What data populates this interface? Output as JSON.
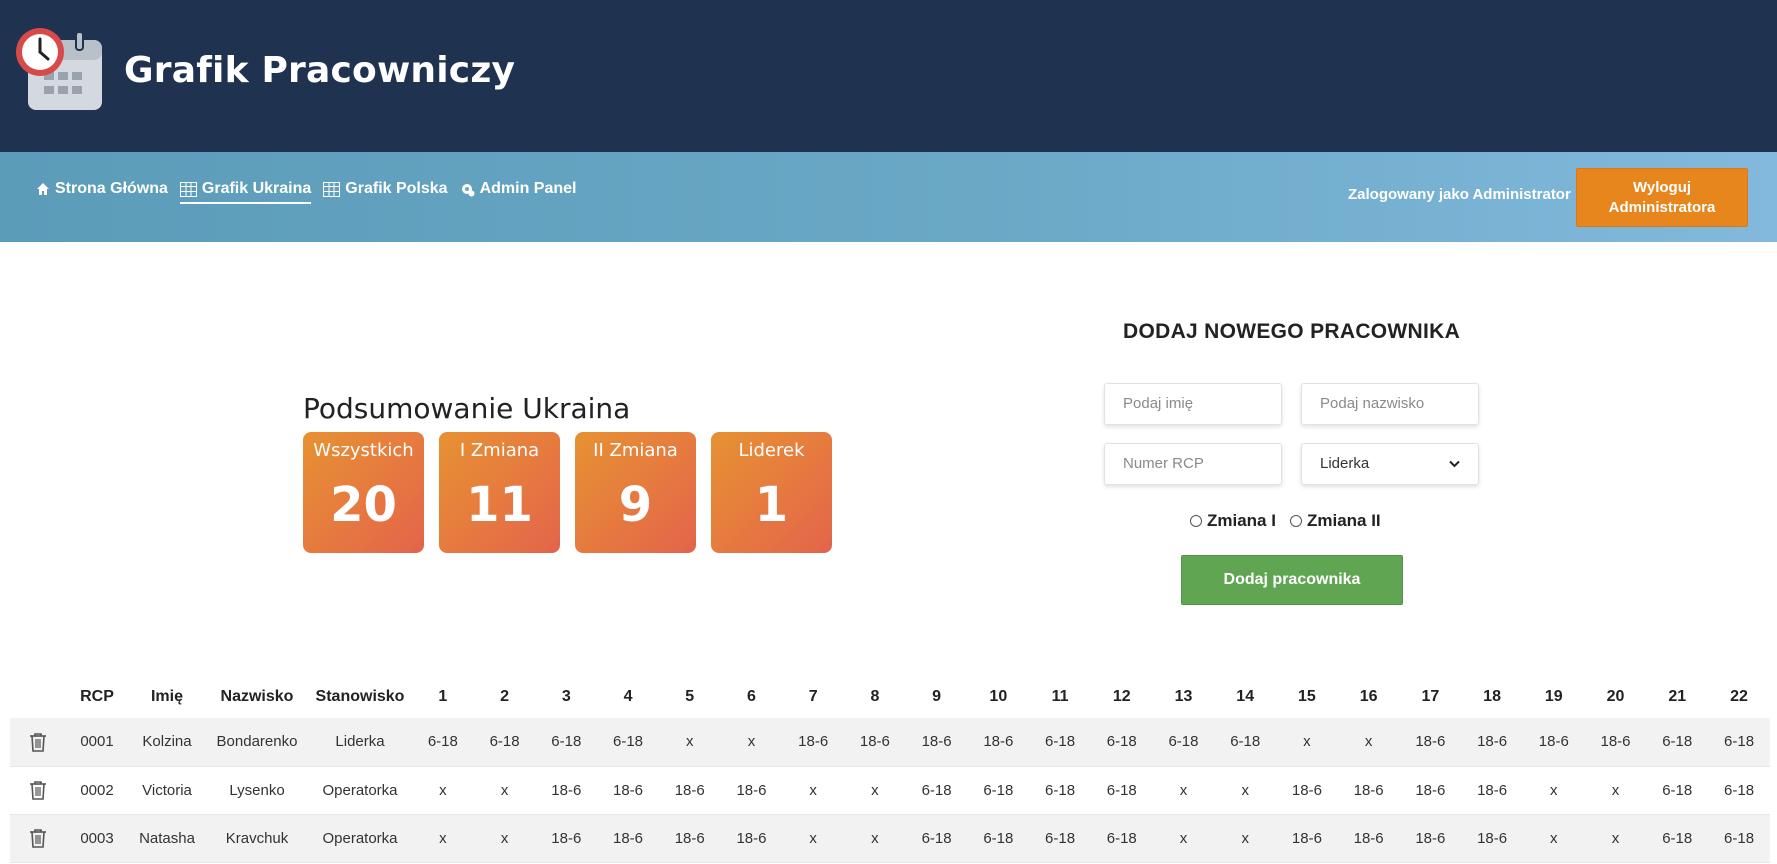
{
  "header": {
    "title": "Grafik Pracowniczy",
    "logo_icon": "calendar-clock-icon"
  },
  "nav": {
    "items": [
      {
        "label": "Strona Główna",
        "icon": "home-icon",
        "active": false
      },
      {
        "label": "Grafik Ukraina",
        "icon": "table-icon",
        "active": true
      },
      {
        "label": "Grafik Polska",
        "icon": "table-icon",
        "active": false
      },
      {
        "label": "Admin Panel",
        "icon": "admin-icon",
        "active": false
      }
    ],
    "logged_as": "Zalogowany jako Administrator",
    "logout_label_line1": "Wyloguj",
    "logout_label_line2": "Administratora"
  },
  "summary": {
    "title": "Podsumowanie Ukraina",
    "cards": [
      {
        "label": "Wszystkich",
        "value": "20"
      },
      {
        "label": "I Zmiana",
        "value": "11"
      },
      {
        "label": "II Zmiana",
        "value": "9"
      },
      {
        "label": "Liderek",
        "value": "1"
      }
    ]
  },
  "form": {
    "title": "DODAJ NOWEGO PRACOWNIKA",
    "first_name_placeholder": "Podaj imię",
    "last_name_placeholder": "Podaj nazwisko",
    "rcp_placeholder": "Numer RCP",
    "position_selected": "Liderka",
    "shift_options": [
      "Zmiana I",
      "Zmiana II"
    ],
    "submit_label": "Dodaj pracownika"
  },
  "table": {
    "headers": [
      "",
      "RCP",
      "Imię",
      "Nazwisko",
      "Stanowisko",
      "1",
      "2",
      "3",
      "4",
      "5",
      "6",
      "7",
      "8",
      "9",
      "10",
      "11",
      "12",
      "13",
      "14",
      "15",
      "16",
      "17",
      "18",
      "19",
      "20",
      "21",
      "22"
    ],
    "rows": [
      {
        "rcp": "0001",
        "first": "Kolzina",
        "last": "Bondarenko",
        "position": "Liderka",
        "days": [
          "6-18",
          "6-18",
          "6-18",
          "6-18",
          "x",
          "x",
          "18-6",
          "18-6",
          "18-6",
          "18-6",
          "6-18",
          "6-18",
          "6-18",
          "6-18",
          "x",
          "x",
          "18-6",
          "18-6",
          "18-6",
          "18-6",
          "6-18",
          "6-18"
        ]
      },
      {
        "rcp": "0002",
        "first": "Victoria",
        "last": "Lysenko",
        "position": "Operatorka",
        "days": [
          "x",
          "x",
          "18-6",
          "18-6",
          "18-6",
          "18-6",
          "x",
          "x",
          "6-18",
          "6-18",
          "6-18",
          "6-18",
          "x",
          "x",
          "18-6",
          "18-6",
          "18-6",
          "18-6",
          "x",
          "x",
          "6-18",
          "6-18"
        ]
      },
      {
        "rcp": "0003",
        "first": "Natasha",
        "last": "Kravchuk",
        "position": "Operatorka",
        "days": [
          "x",
          "x",
          "18-6",
          "18-6",
          "18-6",
          "18-6",
          "x",
          "x",
          "6-18",
          "6-18",
          "6-18",
          "6-18",
          "x",
          "x",
          "18-6",
          "18-6",
          "18-6",
          "18-6",
          "x",
          "x",
          "6-18",
          "6-18"
        ]
      }
    ]
  },
  "colors": {
    "header_bg": "#1f3350",
    "logout_bg": "#e8861e",
    "add_btn_bg": "#5fa552",
    "card_gradient_start": "#e79232",
    "card_gradient_end": "#e4644b"
  }
}
